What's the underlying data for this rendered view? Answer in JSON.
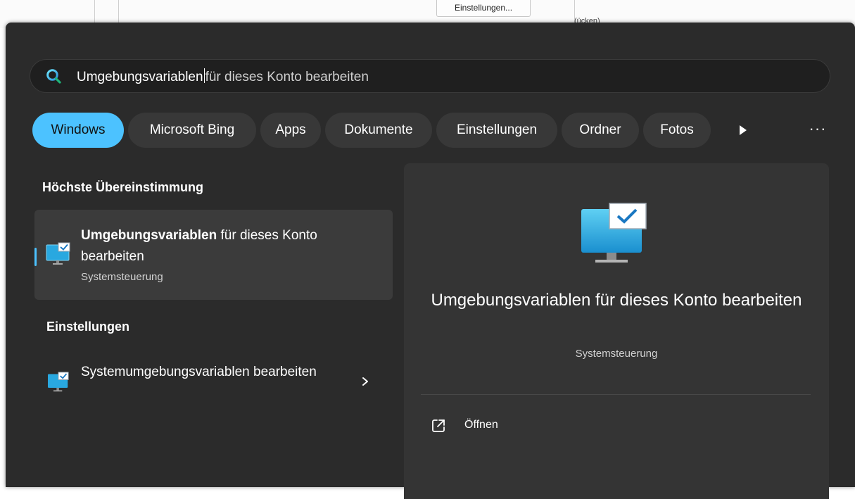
{
  "background_window": {
    "button_label": "Einstellungen...",
    "fragment": "(ücken)"
  },
  "search": {
    "typed": "Umgebungsvariablen",
    "suggestion": "für dieses Konto bearbeiten"
  },
  "tabs": [
    {
      "label": "Windows",
      "active": true
    },
    {
      "label": "Microsoft Bing",
      "active": false
    },
    {
      "label": "Apps",
      "active": false
    },
    {
      "label": "Dokumente",
      "active": false
    },
    {
      "label": "Einstellungen",
      "active": false
    },
    {
      "label": "Ordner",
      "active": false
    },
    {
      "label": "Fotos",
      "active": false
    }
  ],
  "tabs_more_icon": "play-arrow-icon",
  "tabs_overflow_label": "···",
  "best_match": {
    "heading": "Höchste Übereinstimmung",
    "title_bold": "Umgebungsvariablen",
    "title_rest": " für dieses Konto bearbeiten",
    "subtitle": "Systemsteuerung"
  },
  "settings": {
    "heading": "Einstellungen",
    "items": [
      {
        "label": "Systemumgebungsvariablen bearbeiten"
      }
    ]
  },
  "detail": {
    "title": "Umgebungsvariablen für dieses Konto bearbeiten",
    "subtitle": "Systemsteuerung",
    "actions": [
      {
        "label": "Öffnen",
        "icon": "open-external-icon"
      }
    ]
  },
  "colors": {
    "accent": "#4cc2ff",
    "panel": "#2b2b2b",
    "detail_panel": "#343434"
  }
}
